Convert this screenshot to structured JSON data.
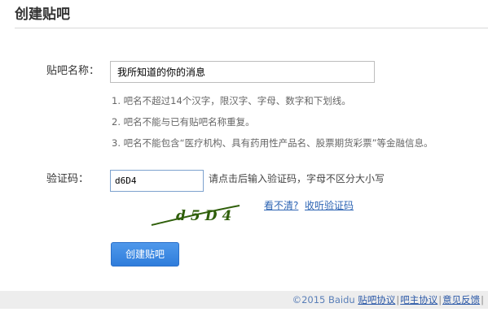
{
  "page": {
    "title": "创建贴吧"
  },
  "form": {
    "name_label": "贴吧名称：",
    "name_value": "我所知道的你的消息",
    "rules": [
      "1. 吧名不超过14个汉字，限汉字、字母、数字和下划线。",
      "2. 吧名不能与已有贴吧名称重复。",
      "3. 吧名不能包含“医疗机构、具有药用性产品名、股票期货彩票”等金融信息。"
    ],
    "captcha_label": "验证码：",
    "captcha_value": "d6D4",
    "captcha_hint": "请点击后输入验证码，字母不区分大小写",
    "captcha_image_text": "d5D4",
    "unclear_link": "看不清?",
    "listen_link": "收听验证码",
    "submit_label": "创建贴吧"
  },
  "footer": {
    "copyright": "©2015 Baidu",
    "links": [
      "贴吧协议",
      "吧主协议",
      "意见反馈"
    ],
    "separator": "|"
  },
  "colors": {
    "link": "#2d64b3",
    "button": "#2f7ddb",
    "footer_bg": "#ededed"
  }
}
